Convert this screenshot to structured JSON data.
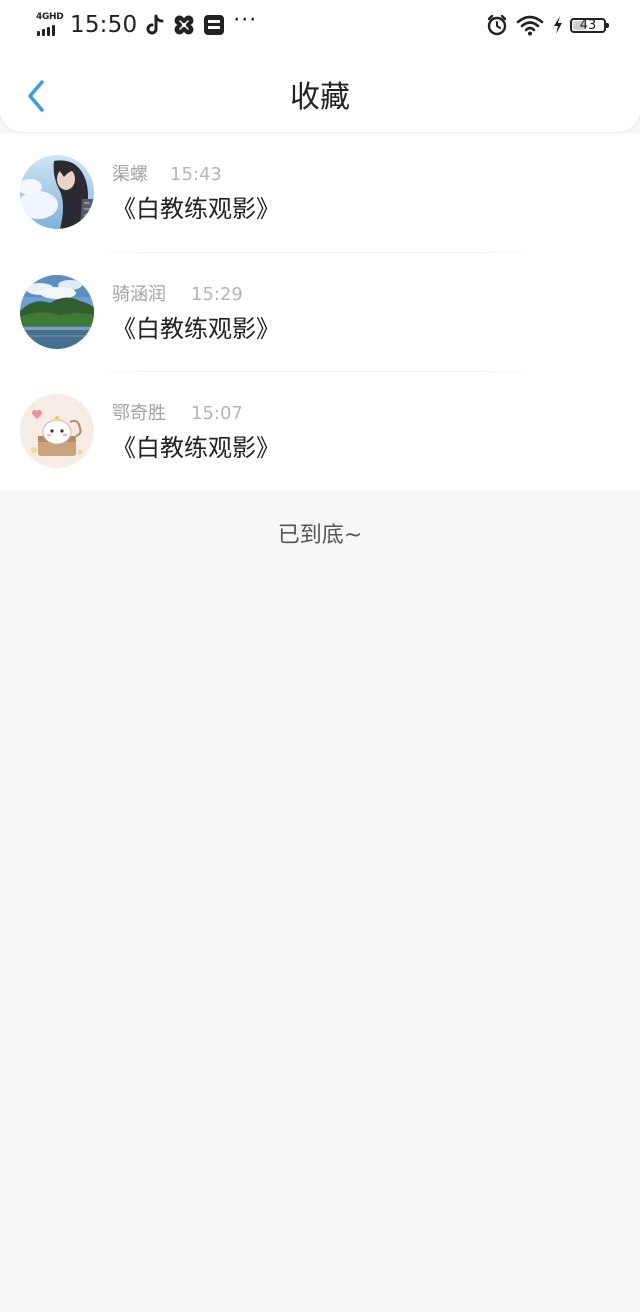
{
  "status_bar": {
    "network": "4GHD",
    "time": "15:50",
    "app_icons": [
      "tiktok-icon",
      "pinwheel-icon",
      "news-icon"
    ],
    "more": "···",
    "battery": "43",
    "battery_level_percent": 43
  },
  "header": {
    "title": "收藏",
    "back_icon": "chevron-left-icon",
    "accent_color": "#2f9bea"
  },
  "favorites": [
    {
      "name": "渠螺",
      "time": "15:43",
      "title": "《白教练观影》",
      "avatar": "portrait-photo"
    },
    {
      "name": "骑涵润",
      "time": "15:29",
      "title": "《白教练观影》",
      "avatar": "landscape-photo"
    },
    {
      "name": "鄂奇胜",
      "time": "15:07",
      "title": "《白教练观影》",
      "avatar": "cartoon-cat"
    }
  ],
  "footer": {
    "end_text": "已到底~"
  }
}
